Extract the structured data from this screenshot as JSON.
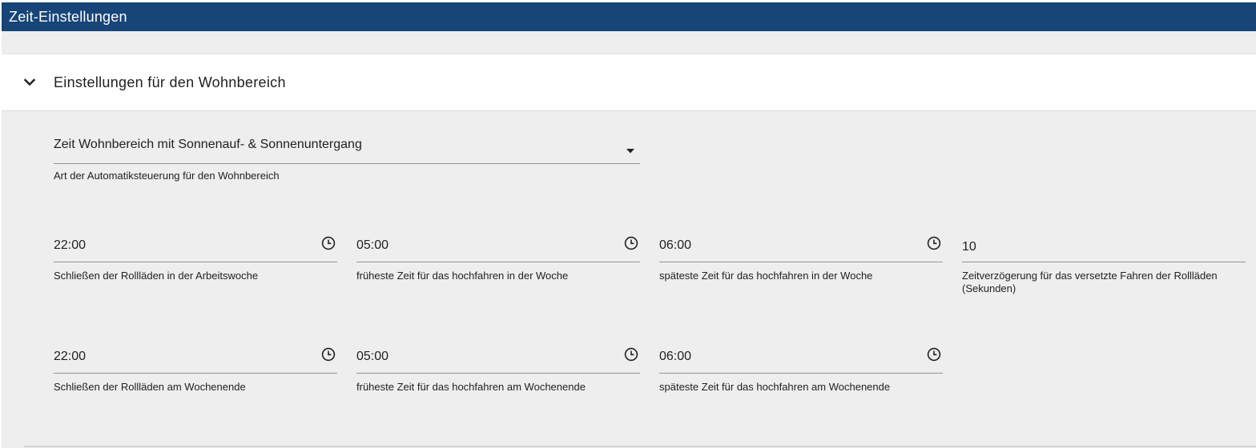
{
  "window": {
    "title": "Zeit-Einstellungen"
  },
  "colors": {
    "titlebar_bg": "#174577",
    "content_bg": "#eeeeee",
    "panel_bg": "#ffffff"
  },
  "panel": {
    "title": "Einstellungen für den Wohnbereich",
    "expanded": true,
    "toggle_icon": "chevron-down-icon"
  },
  "mode_select": {
    "value": "Zeit Wohnbereich mit Sonnenauf- & Sonnenuntergang",
    "helper": "Art der Automatiksteuerung für den Wohnbereich",
    "icon": "dropdown-arrow-icon"
  },
  "week": {
    "close": {
      "value": "22:00",
      "helper": "Schließen der Rollläden in der Arbeitswoche",
      "icon": "clock-icon"
    },
    "earliest_up": {
      "value": "05:00",
      "helper": "früheste Zeit für das hochfahren in der Woche",
      "icon": "clock-icon"
    },
    "latest_up": {
      "value": "06:00",
      "helper": "späteste Zeit für das hochfahren in der Woche",
      "icon": "clock-icon"
    },
    "delay": {
      "value": "10",
      "helper": "Zeitverzögerung für das versetzte Fahren der Rollläden (Sekunden)"
    }
  },
  "weekend": {
    "close": {
      "value": "22:00",
      "helper": "Schließen der Rollläden am Wochenende",
      "icon": "clock-icon"
    },
    "earliest_up": {
      "value": "05:00",
      "helper": "früheste Zeit für das hochfahren am Wochenende",
      "icon": "clock-icon"
    },
    "latest_up": {
      "value": "06:00",
      "helper": "späteste Zeit für das hochfahren am Wochenende",
      "icon": "clock-icon"
    }
  }
}
